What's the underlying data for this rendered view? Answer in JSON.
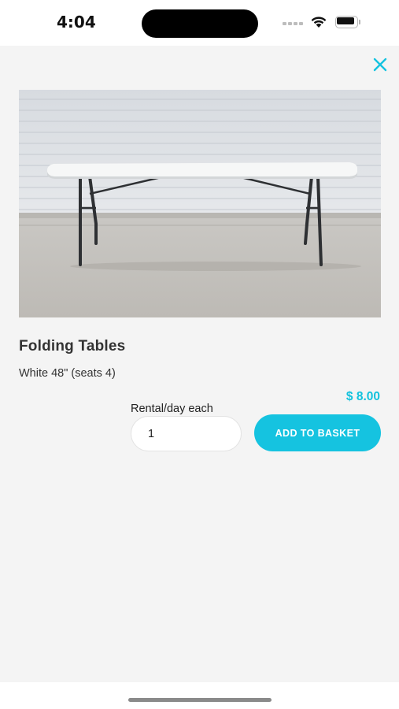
{
  "status_bar": {
    "time": "4:04"
  },
  "product": {
    "title": "Folding Tables",
    "description": "White 48\" (seats 4)",
    "price": "$ 8.00",
    "image_icon": "folding-table-photo"
  },
  "quantity": {
    "label": "Rental/day each",
    "value": "1"
  },
  "actions": {
    "add_to_basket": "ADD TO BASKET",
    "close_icon": "close-icon"
  },
  "colors": {
    "accent": "#15c3e0",
    "background": "#f4f4f4"
  }
}
